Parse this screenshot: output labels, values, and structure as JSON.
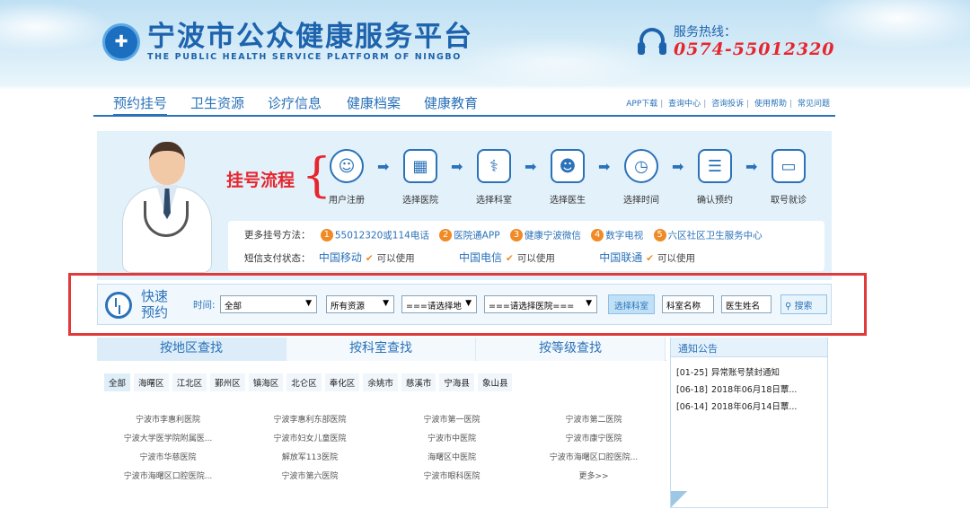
{
  "header": {
    "logo_cn": "宁波市公众健康服务平台",
    "logo_en": "THE PUBLIC HEALTH SERVICE PLATFORM OF NINGBO",
    "hotline_label": "服务热线：",
    "hotline_number": "0574-55012320"
  },
  "nav": {
    "items": [
      {
        "label": "预约挂号",
        "active": true
      },
      {
        "label": "卫生资源"
      },
      {
        "label": "诊疗信息"
      },
      {
        "label": "健康档案"
      },
      {
        "label": "健康教育"
      }
    ],
    "links": [
      "APP下载",
      "查询中心",
      "咨询投诉",
      "使用帮助",
      "常见问题"
    ]
  },
  "process": {
    "title": "挂号流程",
    "steps": [
      {
        "label": "用户注册",
        "icon": "user-icon"
      },
      {
        "label": "选择医院",
        "icon": "hospital-icon"
      },
      {
        "label": "选择科室",
        "icon": "stethoscope-icon"
      },
      {
        "label": "选择医生",
        "icon": "doctor-icon"
      },
      {
        "label": "选择时间",
        "icon": "alarm-clock-icon"
      },
      {
        "label": "确认预约",
        "icon": "id-card-icon"
      },
      {
        "label": "取号就诊",
        "icon": "ticket-icon"
      }
    ],
    "more_methods_label": "更多挂号方法：",
    "methods": [
      {
        "num": "1",
        "text": "55012320或114电话"
      },
      {
        "num": "2",
        "text": "医院通APP"
      },
      {
        "num": "3",
        "text": "健康宁波微信"
      },
      {
        "num": "4",
        "text": "数字电视"
      },
      {
        "num": "5",
        "text": "六区社区卫生服务中心"
      }
    ],
    "sms_label": "短信支付状态：",
    "carriers": [
      {
        "name": "中国移动",
        "status": "可以使用"
      },
      {
        "name": "中国电信",
        "status": "可以使用"
      },
      {
        "name": "中国联通",
        "status": "可以使用"
      }
    ]
  },
  "quick": {
    "title_line1": "快速",
    "title_line2": "预约",
    "time_label": "时间:",
    "time_value": "全部",
    "resource_value": "所有资源",
    "area_value": "===请选择地",
    "hospital_value": "===请选择医院===",
    "dept_button": "选择科室",
    "dept_name": "科室名称",
    "doctor_name": "医生姓名",
    "search_label": "搜索"
  },
  "tabs": [
    "按地区查找",
    "按科室查找",
    "按等级查找"
  ],
  "districts": [
    "全部",
    "海曙区",
    "江北区",
    "鄞州区",
    "镇海区",
    "北仑区",
    "奉化区",
    "余姚市",
    "慈溪市",
    "宁海县",
    "象山县"
  ],
  "hospitals": [
    [
      "宁波市李惠利医院",
      "宁波李惠利东部医院",
      "宁波市第一医院",
      "宁波市第二医院"
    ],
    [
      "宁波大学医学院附属医...",
      "宁波市妇女儿童医院",
      "宁波市中医院",
      "宁波市康宁医院"
    ],
    [
      "宁波市华慈医院",
      "解放军113医院",
      "海曙区中医院",
      "宁波市海曙区口腔医院..."
    ],
    [
      "宁波市海曙区口腔医院...",
      "宁波市第六医院",
      "宁波市眼科医院",
      "更多>>"
    ]
  ],
  "notice": {
    "title": "通知公告",
    "items": [
      {
        "date": "[01-25]",
        "text": "异常账号禁封通知"
      },
      {
        "date": "[06-18]",
        "text": "2018年06月18日蕈..."
      },
      {
        "date": "[06-14]",
        "text": "2018年06月14日蕈..."
      }
    ]
  }
}
